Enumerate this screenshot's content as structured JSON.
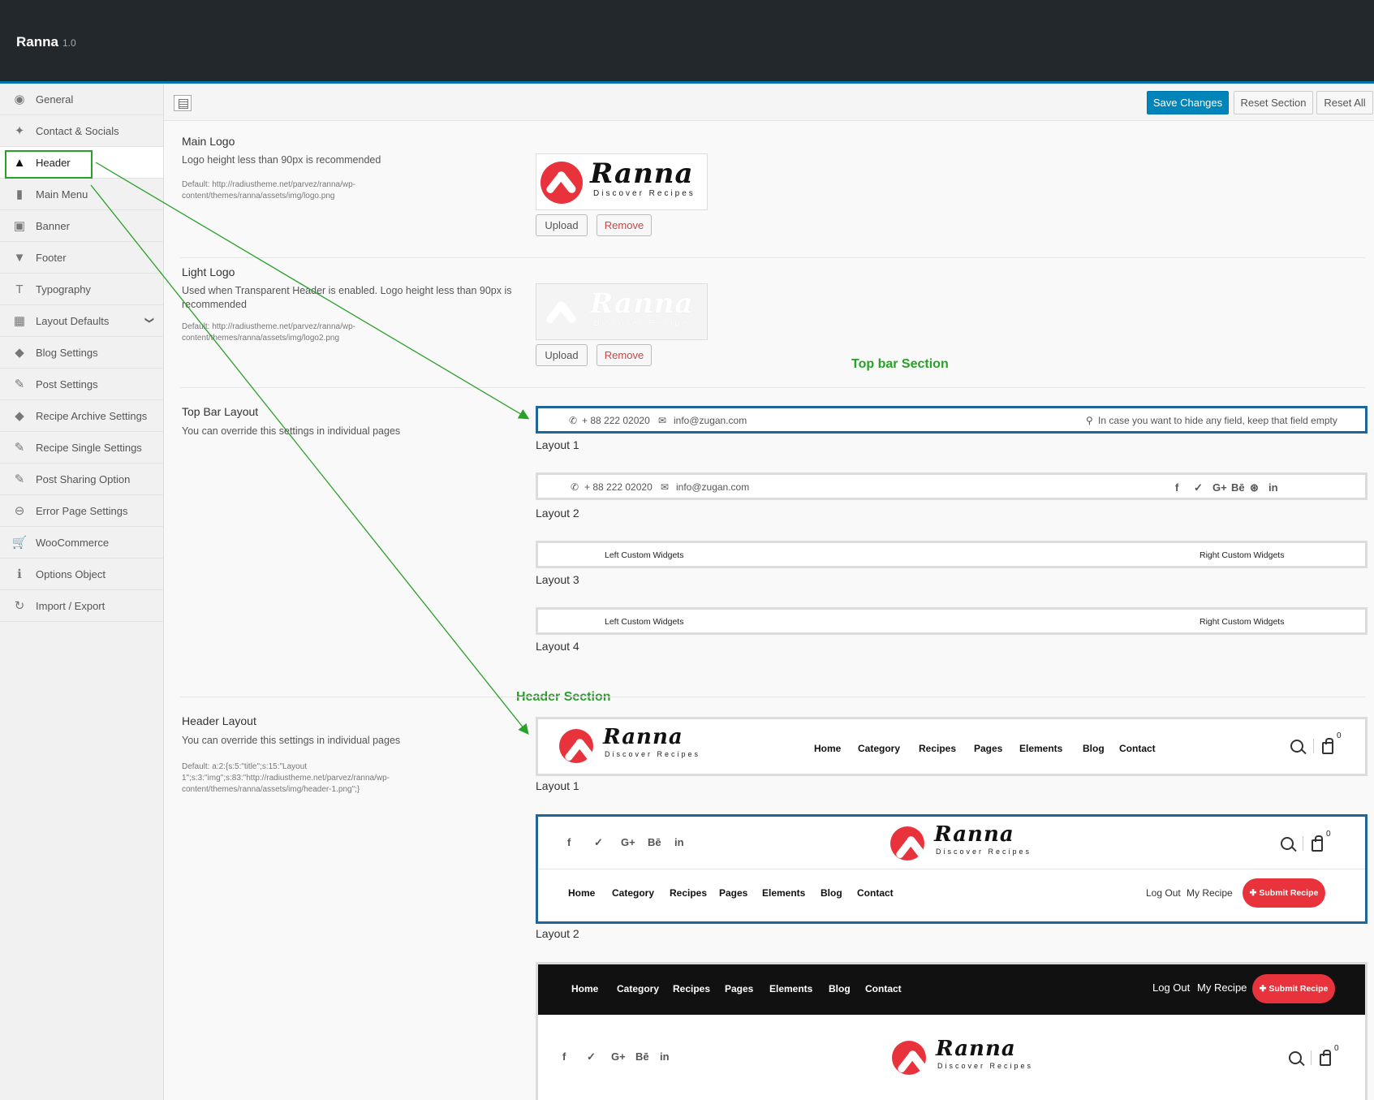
{
  "app": {
    "title": "Ranna",
    "version": "1.0"
  },
  "sidebar": {
    "items": [
      {
        "label": "General",
        "icon": "globe-icon",
        "glyph": "◉"
      },
      {
        "label": "Contact & Socials",
        "icon": "twitter-icon",
        "glyph": "✦"
      },
      {
        "label": "Header",
        "icon": "triangle-icon",
        "glyph": "▲",
        "active": true
      },
      {
        "label": "Main Menu",
        "icon": "book-icon",
        "glyph": "▮"
      },
      {
        "label": "Banner",
        "icon": "image-icon",
        "glyph": "▣"
      },
      {
        "label": "Footer",
        "icon": "triangle-down-icon",
        "glyph": "▼"
      },
      {
        "label": "Typography",
        "icon": "text-icon",
        "glyph": "T"
      },
      {
        "label": "Layout Defaults",
        "icon": "grid-icon",
        "glyph": "▦",
        "chevron": "❯"
      },
      {
        "label": "Blog Settings",
        "icon": "tags-icon",
        "glyph": "◆"
      },
      {
        "label": "Post Settings",
        "icon": "edit-icon",
        "glyph": "✎"
      },
      {
        "label": "Recipe Archive Settings",
        "icon": "tags-icon",
        "glyph": "◆"
      },
      {
        "label": "Recipe Single Settings",
        "icon": "edit-icon",
        "glyph": "✎"
      },
      {
        "label": "Post Sharing Option",
        "icon": "edit-icon",
        "glyph": "✎"
      },
      {
        "label": "Error Page Settings",
        "icon": "minus-circle-icon",
        "glyph": "⊖"
      },
      {
        "label": "WooCommerce",
        "icon": "cart-icon",
        "glyph": "🛒"
      },
      {
        "label": "Options Object",
        "icon": "info-icon",
        "glyph": "ℹ"
      },
      {
        "label": "Import / Export",
        "icon": "refresh-icon",
        "glyph": "↻"
      }
    ]
  },
  "toolbar": {
    "save_label": "Save Changes",
    "reset_section_label": "Reset Section",
    "reset_all_label": "Reset All"
  },
  "main_logo": {
    "title": "Main Logo",
    "desc": "Logo height less than 90px is recommended",
    "default": "Default: http://radiustheme.net/parvez/ranna/wp-content/themes/ranna/assets/img/logo.png",
    "upload_label": "Upload",
    "remove_label": "Remove"
  },
  "light_logo": {
    "title": "Light Logo",
    "desc": "Used when Transparent Header is enabled. Logo height less than 90px is recommended",
    "default": "Default: http://radiustheme.net/parvez/ranna/wp-content/themes/ranna/assets/img/logo2.png",
    "upload_label": "Upload",
    "remove_label": "Remove"
  },
  "brand": {
    "word": "Ranna",
    "tagline": "Discover Recipes",
    "accent": "#e8333c"
  },
  "annotations": {
    "top_bar_section": "Top bar Section",
    "header_section": "Header Section",
    "color": "#2aa02a"
  },
  "top_bar": {
    "title": "Top Bar Layout",
    "desc": "You can override this settings in individual pages",
    "phone": "+ 88 222 02020",
    "email": "info@zugan.com",
    "note": "In case you want to hide any field, keep that field empty",
    "left_widgets": "Left Custom Widgets",
    "right_widgets": "Right Custom Widgets",
    "socials": [
      "f",
      "✓",
      "G+",
      "Bē",
      "⊛",
      "in"
    ],
    "layouts": [
      "Layout 1",
      "Layout 2",
      "Layout 3",
      "Layout 4"
    ]
  },
  "header": {
    "title": "Header Layout",
    "desc": "You can override this settings in individual pages",
    "default": "Default: a:2:{s:5:\"title\";s:15:\"Layout 1\";s:3:\"img\";s:83:\"http://radiustheme.net/parvez/ranna/wp-content/themes/ranna/assets/img/header-1.png\";}",
    "nav": [
      "Home",
      "Category",
      "Recipes",
      "Pages",
      "Elements",
      "Blog",
      "Contact"
    ],
    "socials": [
      "f",
      "✓",
      "G+",
      "Bē",
      "in"
    ],
    "cart_count": "0",
    "log_out": "Log Out",
    "my_recipe": "My Recipe",
    "submit_label": "✚ Submit Recipe",
    "layouts": [
      "Layout 1",
      "Layout 2"
    ]
  }
}
